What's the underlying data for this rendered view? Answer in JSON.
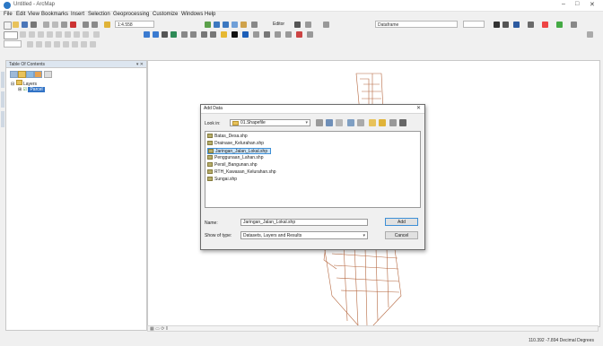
{
  "window": {
    "title": "Untitled - ArcMap"
  },
  "menu": [
    "File",
    "Edit",
    "View",
    "Bookmarks",
    "Insert",
    "Selection",
    "Geoprocessing",
    "Customize",
    "Windows",
    "Help"
  ],
  "toolbar": {
    "scale": "1:4.558",
    "editor_label": "Editor",
    "layer_field": "Dataframe"
  },
  "toc": {
    "title": "Table Of Contents",
    "group_label": "Layers",
    "layer_label": "Parcel"
  },
  "dialog": {
    "title": "Add Data",
    "look_in_label": "Look in:",
    "look_in_value": "01.Shapefile",
    "files": [
      "Batas_Desa.shp",
      "Drainase_Kelurahan.shp",
      "Jaringan_Jalan_Lokal.shp",
      "Penggunaan_Lahan.shp",
      "Persil_Bangunan.shp",
      "RTH_Kawasan_Kelurahan.shp",
      "Sungai.shp"
    ],
    "selected_index": 2,
    "name_label": "Name:",
    "name_value": "Jaringan_Jalan_Lokal.shp",
    "type_label": "Show of type:",
    "type_value": "Datasets, Layers and Results",
    "add_button": "Add",
    "cancel_button": "Cancel"
  },
  "status": {
    "coords": "110.392  -7.894 Decimal Degrees"
  }
}
